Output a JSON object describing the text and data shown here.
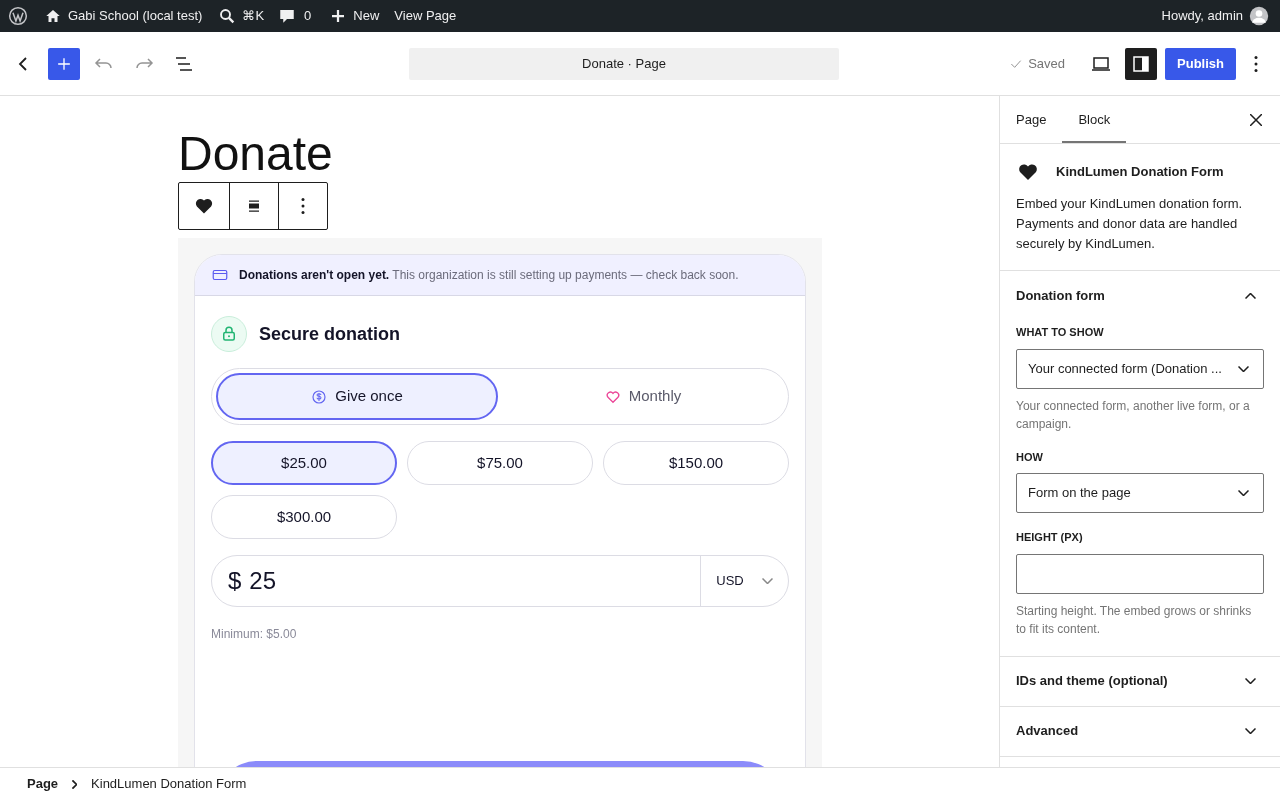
{
  "admin_bar": {
    "site": "Gabi School (local test)",
    "search_shortcut": "⌘K",
    "comments": "0",
    "new_label": "New",
    "view_label": "View Page",
    "greeting": "Howdy, admin"
  },
  "header": {
    "document_title": "Donate · Page",
    "status": "Saved",
    "publish": "Publish",
    "settings_open": true
  },
  "page": {
    "title": "Donate"
  },
  "donation_form": {
    "notice_title": "Donations aren't open yet.",
    "notice_text": "This organization is still setting up payments — check back soon.",
    "heading": "Secure donation",
    "frequency": [
      {
        "label": "Give once",
        "kind": "once",
        "selected": true
      },
      {
        "label": "Monthly",
        "kind": "monthly",
        "selected": false
      }
    ],
    "amounts": [
      {
        "label": "$25.00",
        "selected": true
      },
      {
        "label": "$75.00",
        "selected": false
      },
      {
        "label": "$150.00",
        "selected": false
      },
      {
        "label": "$300.00",
        "selected": false
      }
    ],
    "currency_symbol": "$",
    "amount_value": "25",
    "currency": "USD",
    "minimum": "Minimum: $5.00"
  },
  "sidebar": {
    "tabs": [
      {
        "label": "Page",
        "selected": false
      },
      {
        "label": "Block",
        "selected": true
      }
    ],
    "block": {
      "name": "KindLumen Donation Form",
      "description": "Embed your KindLumen donation form. Payments and donor data are handled securely by KindLumen."
    },
    "panels": [
      {
        "title": "Donation form",
        "expanded": true,
        "fields": [
          {
            "kind": "select",
            "label": "WHAT TO SHOW",
            "value": "Your connected form (Donation ...",
            "help": "Your connected form, another live form, or a campaign."
          },
          {
            "kind": "select",
            "label": "HOW",
            "value": "Form on the page"
          },
          {
            "kind": "input",
            "label": "HEIGHT (PX)",
            "help": "Starting height. The embed grows or shrinks to fit its content."
          }
        ]
      },
      {
        "title": "IDs and theme (optional)",
        "expanded": false
      },
      {
        "title": "Advanced",
        "expanded": false
      }
    ]
  },
  "breadcrumb": [
    "Page",
    "KindLumen Donation Form"
  ]
}
